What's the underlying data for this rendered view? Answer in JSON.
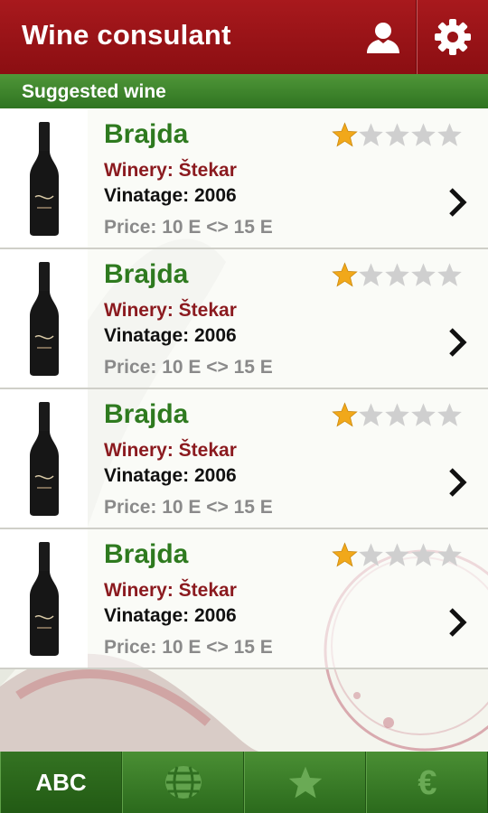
{
  "header": {
    "title": "Wine consulant",
    "user_icon": "user-icon",
    "settings_icon": "gear-icon"
  },
  "section": {
    "title": "Suggested wine"
  },
  "wines": [
    {
      "name": "Brajda",
      "winery": "Winery: Štekar",
      "vintage": "Vinatage: 2006",
      "price": "Price: 10 E <> 15 E",
      "rating": 1,
      "max_rating": 5
    },
    {
      "name": "Brajda",
      "winery": "Winery: Štekar",
      "vintage": "Vinatage: 2006",
      "price": "Price: 10 E <> 15 E",
      "rating": 1,
      "max_rating": 5
    },
    {
      "name": "Brajda",
      "winery": "Winery: Štekar",
      "vintage": "Vinatage: 2006",
      "price": "Price: 10 E <> 15 E",
      "rating": 1,
      "max_rating": 5
    },
    {
      "name": "Brajda",
      "winery": "Winery: Štekar",
      "vintage": "Vinatage: 2006",
      "price": "Price: 10 E <> 15 E",
      "rating": 1,
      "max_rating": 5
    }
  ],
  "tabs": [
    {
      "label": "ABC",
      "icon": "abc-text",
      "active": true
    },
    {
      "label": "",
      "icon": "barrel-icon",
      "active": false
    },
    {
      "label": "",
      "icon": "star-icon",
      "active": false
    },
    {
      "label": "",
      "icon": "euro-icon",
      "active": false
    }
  ],
  "colors": {
    "header": "#9a1317",
    "section": "#3f8a2c",
    "wine_name": "#2e7a1f",
    "winery": "#8b1a1f",
    "star_filled": "#f1a81a",
    "star_empty": "#cfcfcf"
  }
}
